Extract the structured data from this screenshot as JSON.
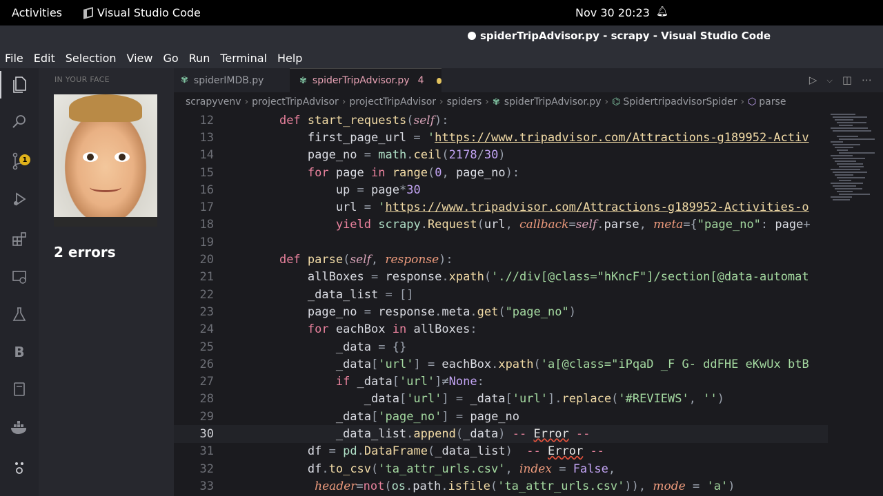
{
  "topbar": {
    "activities": "Activities",
    "app": "Visual Studio Code",
    "clock": "Nov 30  20:23"
  },
  "window": {
    "title": "spiderTripAdvisor.py - scrapy - Visual Studio Code"
  },
  "menu": [
    "File",
    "Edit",
    "Selection",
    "View",
    "Go",
    "Run",
    "Terminal",
    "Help"
  ],
  "activity_badge": "1",
  "sidebar": {
    "section": "IN YOUR FACE",
    "errors": "2 errors"
  },
  "tabs": [
    {
      "label": "spiderIMDB.py"
    },
    {
      "label": "spiderTripAdvisor.py",
      "count": "4"
    }
  ],
  "breadcrumb": [
    "scrapyvenv",
    "projectTripAdvisor",
    "projectTripAdvisor",
    "spiders",
    "spiderTripAdvisor.py",
    "SpidertripadvisorSpider",
    "parse"
  ],
  "editor": {
    "lines": [
      {
        "no": "12",
        "text": "    def start_requests(self):"
      },
      {
        "no": "13",
        "text": "        first_page_url = 'https://www.tripadvisor.com/Attractions-g189952-Activ"
      },
      {
        "no": "14",
        "text": "        page_no = math.ceil(2178/30)"
      },
      {
        "no": "15",
        "text": "        for page in range(0, page_no):"
      },
      {
        "no": "16",
        "text": "            up = page*30"
      },
      {
        "no": "17",
        "text": "            url = 'https://www.tripadvisor.com/Attractions-g189952-Activities-o"
      },
      {
        "no": "18",
        "text": "            yield scrapy.Request(url, callback=self.parse, meta={\"page_no\": page+"
      },
      {
        "no": "19",
        "text": ""
      },
      {
        "no": "20",
        "text": "    def parse(self, response):"
      },
      {
        "no": "21",
        "text": "        allBoxes = response.xpath('.//div[@class=\"hKncF\"]/section[@data-automat"
      },
      {
        "no": "22",
        "text": "        _data_list = []"
      },
      {
        "no": "23",
        "text": "        page_no = response.meta.get(\"page_no\")"
      },
      {
        "no": "24",
        "text": "        for eachBox in allBoxes:"
      },
      {
        "no": "25",
        "text": "            _data = {}"
      },
      {
        "no": "26",
        "text": "            _data['url'] = eachBox.xpath('a[@class=\"iPqaD _F G- ddFHE eKwUx btB"
      },
      {
        "no": "27",
        "text": "            if _data['url']≠None:"
      },
      {
        "no": "28",
        "text": "                _data['url'] = _data['url'].replace('#REVIEWS', '')"
      },
      {
        "no": "29",
        "text": "            _data['page_no'] = page_no"
      },
      {
        "no": "30",
        "text": "            _data_list.append(_data) -- Error --"
      },
      {
        "no": "31",
        "text": "        df = pd.DataFrame(_data_list)  -- Error --"
      },
      {
        "no": "32",
        "text": "        df.to_csv('ta_attr_urls.csv', index = False,"
      },
      {
        "no": "33",
        "text": "         header=not(os.path.isfile('ta_attr_urls.csv')), mode = 'a')"
      }
    ]
  }
}
